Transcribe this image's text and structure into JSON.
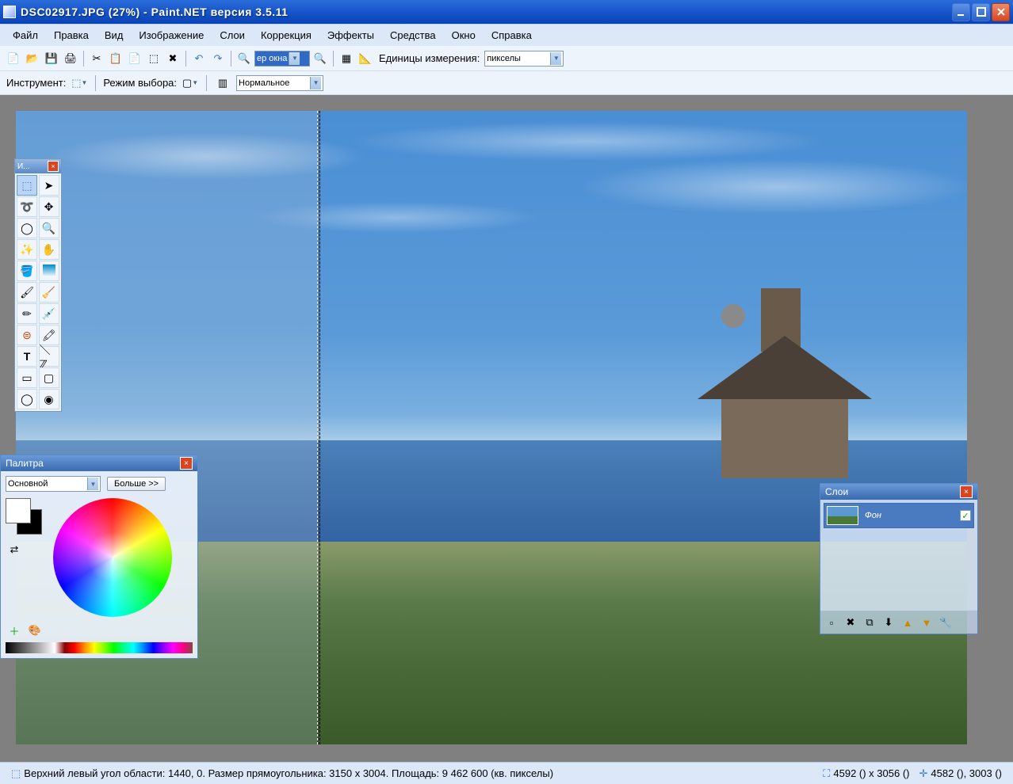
{
  "titlebar": {
    "text": "DSC02917.JPG (27%) - Paint.NET версия 3.5.11"
  },
  "menu": {
    "file": "Файл",
    "edit": "Правка",
    "view": "Вид",
    "image": "Изображение",
    "layers": "Слои",
    "adjust": "Коррекция",
    "effects": "Эффекты",
    "tools": "Средства",
    "window": "Окно",
    "help": "Справка"
  },
  "toolbar1": {
    "zoom_value": "ер окна",
    "units_label": "Единицы измерения:",
    "units_value": "пикселы"
  },
  "toolbar2": {
    "tool_label": "Инструмент:",
    "mode_label": "Режим выбора:",
    "blend_value": "Нормальное"
  },
  "tools_panel": {
    "title": "И..."
  },
  "colors_panel": {
    "title": "Палитра",
    "combo": "Основной",
    "more": "Больше >>"
  },
  "layers_panel": {
    "title": "Слои",
    "layer1": "Фон"
  },
  "status": {
    "selection_info": "Верхний левый угол области: 1440, 0. Размер прямоугольника: 3150 x 3004. Площадь: 9 462 600 (кв. пикселы)",
    "img_size": "4592 () x 3056 ()",
    "cursor_pos": "4582 (), 3003 ()"
  }
}
